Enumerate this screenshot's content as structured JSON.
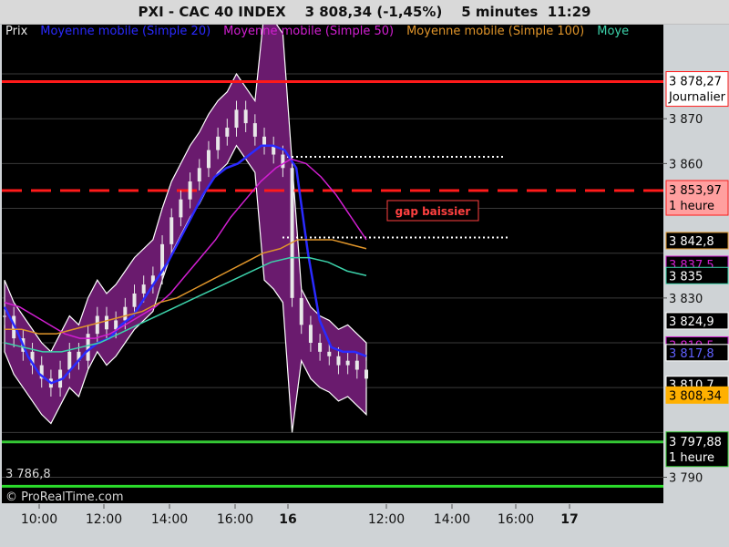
{
  "window": {
    "title": "PXI - CAC 40 INDEX    3 808,34 (-1,45%)    5 minutes  11:29"
  },
  "legend": [
    {
      "label": "Prix",
      "color": "#e8e8e8"
    },
    {
      "label": "Moyenne mobile (Simple 20)",
      "color": "#2a2aff"
    },
    {
      "label": "Moyenne mobile (Simple 50)",
      "color": "#d21fd2"
    },
    {
      "label": "Moyenne mobile (Simple 100)",
      "color": "#e0952a"
    },
    {
      "label": "Moye",
      "color": "#3cd2aa"
    }
  ],
  "watermark": "© ProRealTime.com",
  "annotation": {
    "text": "gap baissier",
    "color": "#ff4040"
  },
  "chart_data": {
    "type": "line",
    "background": "#000000",
    "panel_background": "#cfd3d6",
    "grid": true,
    "ylim": [
      3784.2,
      3891.2
    ],
    "y_ticks": [
      3790,
      3830,
      3860,
      3870
    ],
    "y_tick_labels": [
      "3 790",
      "3 830",
      "3 860",
      "3 870"
    ],
    "x_tick_labels": [
      {
        "label": "10:00",
        "bold": false
      },
      {
        "label": "12:00",
        "bold": false
      },
      {
        "label": "14:00",
        "bold": false
      },
      {
        "label": "16:00",
        "bold": false
      },
      {
        "label": "16",
        "bold": true
      },
      {
        "label": "12:00",
        "bold": false
      },
      {
        "label": "14:00",
        "bold": false
      },
      {
        "label": "16:00",
        "bold": false
      },
      {
        "label": "17",
        "bold": true
      }
    ],
    "min_label": "3 786,8",
    "levels": [
      {
        "value": 3878.27,
        "label": "3 878,27",
        "sub": "Journalier",
        "color": "#ff1a1a",
        "style": "solid",
        "box_bg": "#ffffff",
        "box_fg": "#000000"
      },
      {
        "value": 3853.97,
        "label": "3 853,97",
        "sub": "1 heure",
        "color": "#ff1a1a",
        "style": "dashed",
        "box_bg": "#ff9f9f",
        "box_fg": "#000000"
      },
      {
        "value": 3797.88,
        "label": "3 797,88",
        "sub": "1 heure",
        "color": "#35c835",
        "style": "solid",
        "box_bg": "#000000",
        "box_fg": "#ffffff"
      },
      {
        "value": 3788.0,
        "label": "",
        "sub": "",
        "color": "#2bdc2b",
        "style": "solid",
        "box_bg": "",
        "box_fg": ""
      }
    ],
    "value_tags": [
      {
        "value": 3842.8,
        "label": "3 842,8",
        "bg": "#000000",
        "fg": "#ffffff",
        "border": "#e0952a"
      },
      {
        "value": 3837.5,
        "label": "3 837,5",
        "bg": "#000000",
        "fg": "#d21fd2",
        "border": "#d21fd2"
      },
      {
        "value": 3835,
        "label": "3 835",
        "bg": "#000000",
        "fg": "#ffffff",
        "border": "#3cd2aa"
      },
      {
        "value": 3824.9,
        "label": "3 824,9",
        "bg": "#000000",
        "fg": "#ffffff",
        "border": "#ffffff"
      },
      {
        "value": 3819.5,
        "label": "3 819,5",
        "bg": "#000000",
        "fg": "#d21fd2",
        "border": "#d21fd2"
      },
      {
        "value": 3817.8,
        "label": "3 817,8",
        "bg": "#000000",
        "fg": "#6060ff",
        "border": "#ffffff"
      },
      {
        "value": 3810.7,
        "label": "3 810,7",
        "bg": "#000000",
        "fg": "#ffffff",
        "border": "#ffffff"
      },
      {
        "value": 3808.34,
        "label": "3 808,34",
        "bg": "#ffb000",
        "fg": "#000000",
        "border": "#ffb000"
      }
    ],
    "gap_lines": [
      3861.5,
      3843.5
    ],
    "series": [
      {
        "name": "Prix",
        "values": [
          3826,
          3821,
          3818,
          3815,
          3812,
          3810,
          3814,
          3818,
          3816,
          3822,
          3826,
          3823,
          3825,
          3828,
          3831,
          3833,
          3835,
          3842,
          3848,
          3852,
          3856,
          3859,
          3863,
          3866,
          3868,
          3872,
          3869,
          3866,
          3864,
          3862,
          3859,
          3830,
          3824,
          3820,
          3818,
          3817,
          3815,
          3816,
          3814,
          3812
        ]
      },
      {
        "name": "Moyenne mobile (Simple 20)",
        "values": [
          3828,
          3823,
          3817,
          3813,
          3811,
          3812,
          3815,
          3818,
          3820,
          3821,
          3824,
          3826,
          3830,
          3834,
          3838,
          3843,
          3848,
          3853,
          3857,
          3859,
          3860,
          3862,
          3864,
          3864,
          3863,
          3859,
          3840,
          3825,
          3819,
          3818,
          3818,
          3817
        ]
      },
      {
        "name": "Moyenne mobile (Simple 50)",
        "values": [
          3829,
          3828,
          3826,
          3824,
          3822,
          3821,
          3821,
          3822,
          3824,
          3826,
          3828,
          3831,
          3835,
          3839,
          3843,
          3848,
          3852,
          3856,
          3859,
          3861,
          3860,
          3857,
          3853,
          3848,
          3843
        ]
      },
      {
        "name": "Moyenne mobile (Simple 100)",
        "values": [
          3823,
          3823,
          3822,
          3822,
          3823,
          3824,
          3825,
          3826,
          3827,
          3829,
          3830,
          3832,
          3834,
          3836,
          3838,
          3840,
          3841,
          3843,
          3843,
          3843,
          3842,
          3841
        ]
      },
      {
        "name": "Moye",
        "values": [
          3820,
          3819,
          3818,
          3818,
          3819,
          3820,
          3822,
          3824,
          3826,
          3828,
          3830,
          3832,
          3834,
          3836,
          3838,
          3839,
          3839,
          3838,
          3836,
          3835
        ]
      }
    ]
  }
}
